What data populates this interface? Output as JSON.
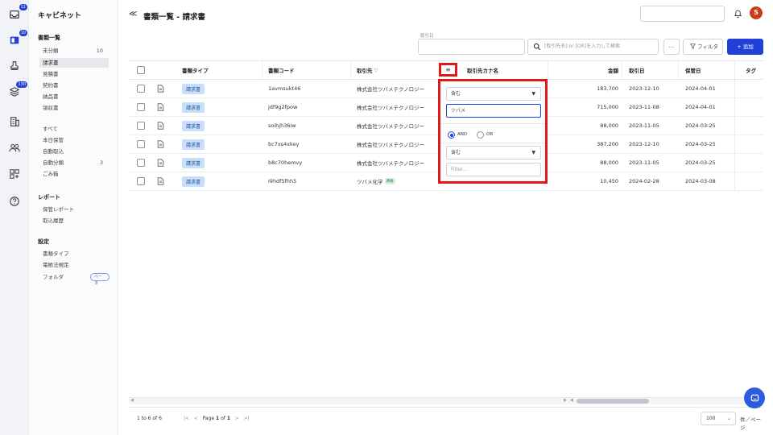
{
  "rail": {
    "badges": [
      "11",
      "10",
      "130"
    ]
  },
  "sidebar": {
    "brand": "キャビネット",
    "section_docs": "書類一覧",
    "uncat": {
      "label": "未分類",
      "count": "10"
    },
    "doc_types": [
      "請求書",
      "見積書",
      "契約書",
      "納品書",
      "領収書"
    ],
    "items2": [
      {
        "label": "すべて",
        "count": ""
      },
      {
        "label": "本日保管",
        "count": ""
      },
      {
        "label": "自動取込",
        "count": ""
      },
      {
        "label": "自動分類",
        "count": "3"
      },
      {
        "label": "ごみ箱",
        "count": ""
      }
    ],
    "section_report": "レポート",
    "report_items": [
      "保管レポート",
      "取込履歴"
    ],
    "section_settings": "設定",
    "settings_items": [
      "書類タイプ",
      "電帳法規定",
      "フォルダ"
    ],
    "beta_label": "ベータ"
  },
  "header": {
    "back": "≪",
    "title": "書類一覧 - 請求書",
    "avatar": "S"
  },
  "filters": {
    "date_label": "取引日",
    "keyword_placeholder": "[取引先名] or [OR]を入力して検索",
    "more": "...",
    "filter_btn": "フィルタ",
    "add_btn": "+ 追加"
  },
  "table": {
    "headers": {
      "type": "書類タイプ",
      "code": "書類コード",
      "partner": "取引先",
      "partner_filter_mark": "▽",
      "menu": "≡",
      "kana": "取引先カナ名",
      "amount": "金額",
      "date": "取引日",
      "stored": "保管日",
      "tag": "タグ"
    },
    "rows": [
      {
        "type": "請求書",
        "code": "1avmsukt46",
        "partner": "株式会社ツバメテクノロジー",
        "badge": "",
        "amount": "183,700",
        "date": "2023-12-10",
        "stored": "2024-04-01"
      },
      {
        "type": "請求書",
        "code": "jdf9g2fpow",
        "partner": "株式会社ツバメテクノロジー",
        "badge": "",
        "amount": "715,000",
        "date": "2023-11-08",
        "stored": "2024-04-01"
      },
      {
        "type": "請求書",
        "code": "soihjh36iw",
        "partner": "株式会社ツバメテクノロジー",
        "badge": "",
        "amount": "88,000",
        "date": "2023-11-05",
        "stored": "2024-03-25"
      },
      {
        "type": "請求書",
        "code": "bc7xs4xkey",
        "partner": "株式会社ツバメテクノロジー",
        "badge": "",
        "amount": "387,200",
        "date": "2023-12-10",
        "stored": "2024-03-25"
      },
      {
        "type": "請求書",
        "code": "b8c70hemvy",
        "partner": "株式会社ツバメテクノロジー",
        "badge": "",
        "amount": "88,000",
        "date": "2023-11-05",
        "stored": "2024-03-25"
      },
      {
        "type": "請求書",
        "code": "i9hdf5fhh5",
        "partner": "ツバメ化学",
        "badge": "適格",
        "amount": "10,450",
        "date": "2024-02-28",
        "stored": "2024-03-08"
      }
    ]
  },
  "popup": {
    "cond1": "含む",
    "value1": "ツバメ",
    "and_label": "AND",
    "or_label": "OR",
    "cond2": "含む",
    "value2_placeholder": "Filter..."
  },
  "pager": {
    "count": "1 to 6 of 6",
    "first": "|<",
    "prev": "<",
    "page_prefix": "Page",
    "page": "1",
    "of": "of",
    "total": "1",
    "next": ">",
    "last": ">|",
    "page_size": "100",
    "unit": "件／ページ"
  }
}
